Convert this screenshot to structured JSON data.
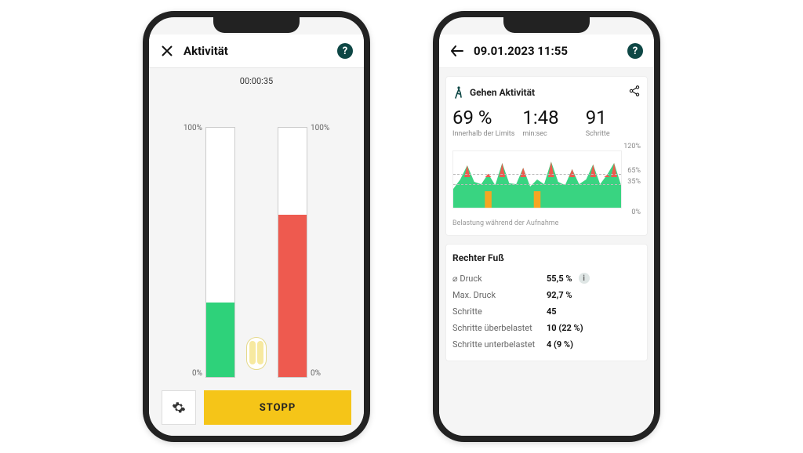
{
  "colors": {
    "accent": "#f5c518",
    "green": "#2ed27a",
    "red": "#ee5a4f",
    "orange": "#f5a623",
    "dark": "#0e4745"
  },
  "screen1": {
    "title": "Aktivität",
    "help": "?",
    "timer": "00:00:35",
    "bar_top_left": "100%",
    "bar_top_right": "100%",
    "bar_bot_left": "0%",
    "bar_bot_right": "0%",
    "left_bar_pct": 30,
    "right_bar_pct": 65,
    "settings_icon": "gear-icon",
    "stop_label": "STOPP"
  },
  "screen2": {
    "title": "09.01.2023 11:55",
    "card_title": "Gehen Aktivität",
    "stat1_value": "69 %",
    "stat1_label": "Innerhalb der Limits",
    "stat2_value": "1:48",
    "stat2_label": "min:sec",
    "stat3_value": "91",
    "stat3_label": "Schritte",
    "chart_top": "120%",
    "chart_65": "65%",
    "chart_35": "35%",
    "chart_bot": "0%",
    "chart_caption": "Belastung während der Aufnahme",
    "foot_section_title": "Rechter Fuß",
    "rows": {
      "druck_k": "⌀ Druck",
      "druck_v": "55,5 %",
      "maxdruck_k": "Max. Druck",
      "maxdruck_v": "92,7 %",
      "schritte_k": "Schritte",
      "schritte_v": "45",
      "ueber_k": "Schritte überbelastet",
      "ueber_v": "10 (22 %)",
      "unter_k": "Schritte unterbelastet",
      "unter_v": "4 (9 %)"
    }
  },
  "chart_data": {
    "type": "area",
    "title": "Belastung während der Aufnahme",
    "ylabel": "%",
    "ylim": [
      0,
      120
    ],
    "target_band": [
      35,
      65
    ],
    "series": [
      {
        "name": "Belastung",
        "values": [
          40,
          60,
          90,
          55,
          50,
          72,
          48,
          95,
          52,
          50,
          85,
          45,
          60,
          50,
          98,
          55,
          48,
          82,
          50,
          60,
          92,
          50,
          70,
          95,
          48
        ]
      }
    ],
    "overload_points": [
      2,
      7,
      10,
      14,
      17,
      20,
      23
    ],
    "underload_points": [
      5,
      12
    ]
  }
}
